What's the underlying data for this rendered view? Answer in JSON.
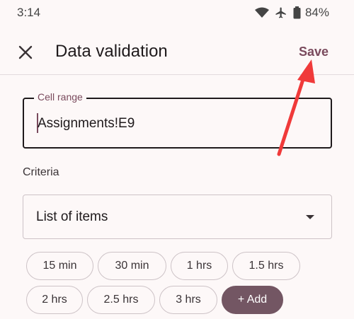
{
  "status_bar": {
    "time": "3:14",
    "battery": "84%",
    "icons": [
      "wifi-icon",
      "airplane-icon",
      "battery-icon"
    ]
  },
  "app_bar": {
    "title": "Data validation",
    "save_label": "Save",
    "close_icon": "close-icon"
  },
  "cell_range": {
    "label": "Cell range",
    "value": "Assignments!E9"
  },
  "criteria": {
    "label": "Criteria",
    "selected": "List of items"
  },
  "items": [
    "15 min",
    "30 min",
    "1 hrs",
    "1.5 hrs",
    "2 hrs",
    "2.5 hrs",
    "3 hrs"
  ],
  "add_label": "+ Add",
  "colors": {
    "accent": "#7a4a5d",
    "chip_add_bg": "#735663",
    "annotation_arrow": "#f03a3a",
    "background": "#fdf8f8"
  }
}
